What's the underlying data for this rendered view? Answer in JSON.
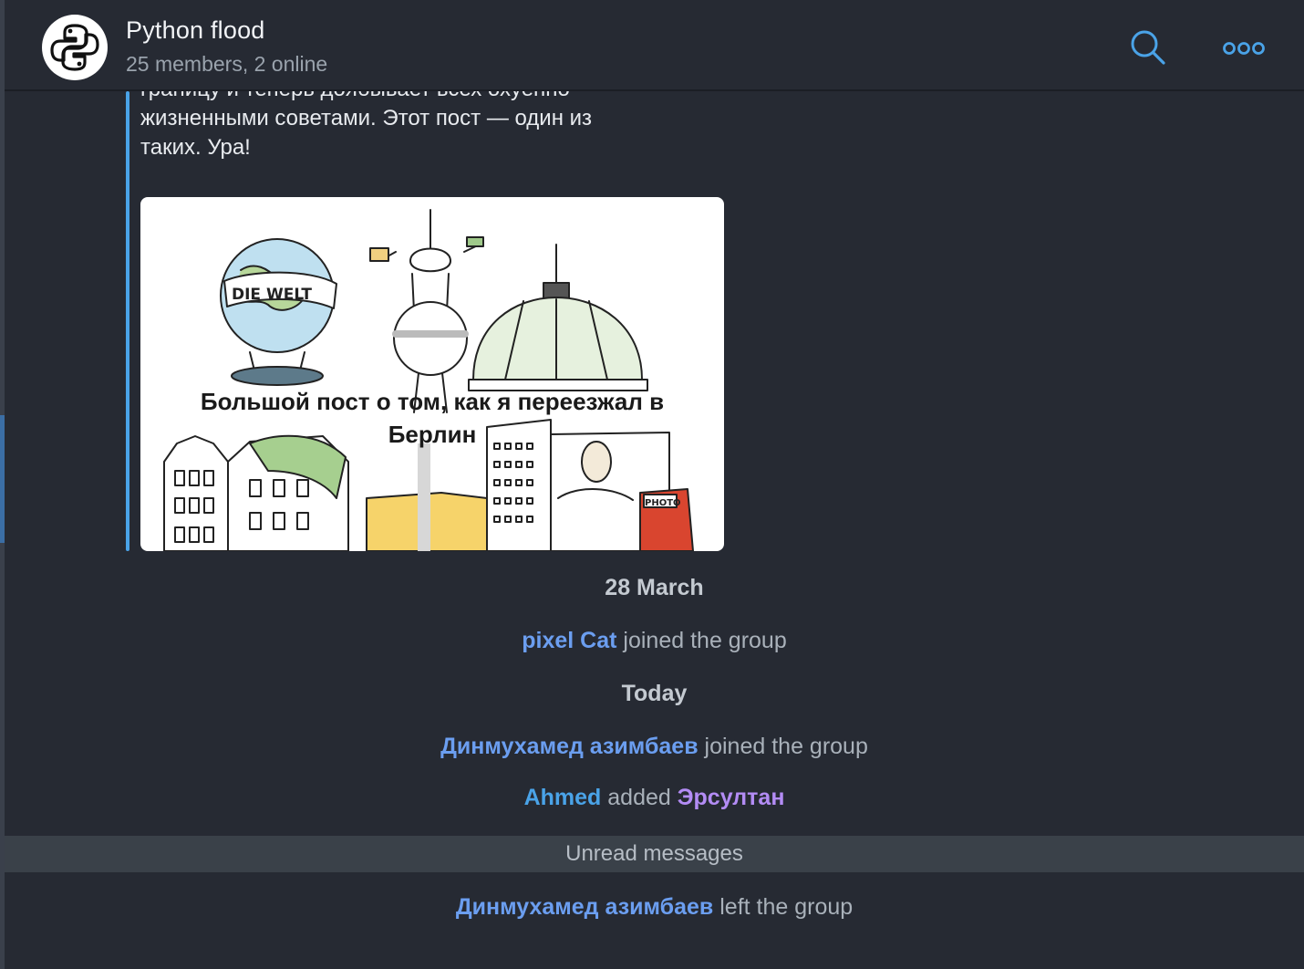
{
  "header": {
    "title": "Python flood",
    "subtitle": "25 members, 2 online"
  },
  "post": {
    "text_lines": [
      "границу и теперь доябывает всех охуенно",
      "жизненными советами. Этот пост — один из",
      "таких. Ура!"
    ],
    "image_caption_line1": "Большой пост о том, как я переезжал в",
    "image_caption_line2": "Берлин",
    "image_labels": {
      "globe": "DIE WELT",
      "booth": "PHOTO"
    }
  },
  "events": {
    "date1": "28 March",
    "join1_name": "pixel Cat",
    "join1_action": "joined the group",
    "date2": "Today",
    "join2_name": "Динмухамед азимбаев",
    "join2_action": "joined the group",
    "add_actor": "Ahmed",
    "add_action": "added",
    "add_target": "Эрсултан",
    "unread_label": "Unread messages",
    "left_name": "Динмухамед азимбаев",
    "left_action": "left the group"
  },
  "colors": {
    "background": "#262a33",
    "accent": "#4aa3e8",
    "name_blue": "#6b9ef0",
    "name_purple": "#b38cf5"
  },
  "icons": {
    "avatar": "python-logo-icon",
    "search": "search-icon",
    "more": "more-icon"
  }
}
